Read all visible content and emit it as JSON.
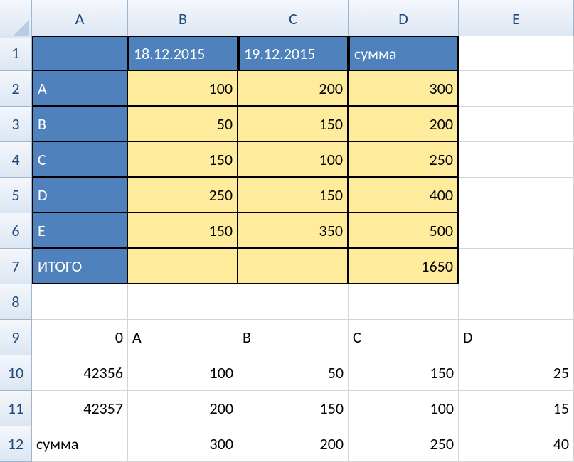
{
  "columns": [
    "A",
    "B",
    "C",
    "D",
    "E"
  ],
  "rows": [
    "1",
    "2",
    "3",
    "4",
    "5",
    "6",
    "7",
    "8",
    "9",
    "10",
    "11",
    "12"
  ],
  "grid": {
    "r1": {
      "A": "",
      "B": "18.12.2015",
      "C": "19.12.2015",
      "D": "сумма",
      "E": ""
    },
    "r2": {
      "A": "A",
      "B": "100",
      "C": "200",
      "D": "300",
      "E": ""
    },
    "r3": {
      "A": "B",
      "B": "50",
      "C": "150",
      "D": "200",
      "E": ""
    },
    "r4": {
      "A": "C",
      "B": "150",
      "C": "100",
      "D": "250",
      "E": ""
    },
    "r5": {
      "A": "D",
      "B": "250",
      "C": "150",
      "D": "400",
      "E": ""
    },
    "r6": {
      "A": "E",
      "B": "150",
      "C": "350",
      "D": "500",
      "E": ""
    },
    "r7": {
      "A": "ИТОГО",
      "B": "",
      "C": "",
      "D": "1650",
      "E": ""
    },
    "r8": {
      "A": "",
      "B": "",
      "C": "",
      "D": "",
      "E": ""
    },
    "r9": {
      "A": "0",
      "B": "A",
      "C": "B",
      "D": "C",
      "E": "D"
    },
    "r10": {
      "A": "42356",
      "B": "100",
      "C": "50",
      "D": "150",
      "E": "25"
    },
    "r11": {
      "A": "42357",
      "B": "200",
      "C": "150",
      "D": "100",
      "E": "15"
    },
    "r12": {
      "A": "сумма",
      "B": "300",
      "C": "200",
      "D": "250",
      "E": "40"
    }
  }
}
